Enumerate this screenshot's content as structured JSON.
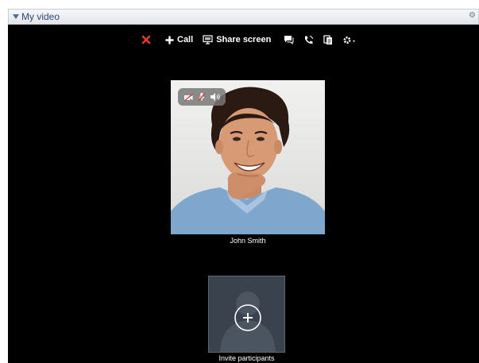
{
  "panel": {
    "title": "My video",
    "gear_icon": "gear-icon"
  },
  "toolbar": {
    "hangup_icon": "close-x-icon",
    "call_label": "Call",
    "share_label": "Share screen",
    "items": [
      "chat-icon",
      "phone-icon",
      "copy-icon",
      "settings-gear-icon"
    ]
  },
  "participant": {
    "name": "John Smith"
  },
  "invite": {
    "label": "Invite participants"
  },
  "colors": {
    "hangup": "#e23b2e",
    "panel_title": "#2c4a73",
    "stage": "#000000"
  }
}
